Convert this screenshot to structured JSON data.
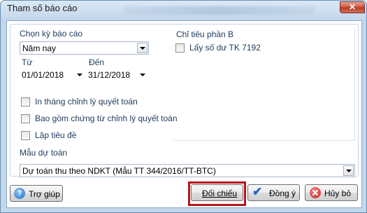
{
  "window": {
    "title": "Tham số báo cáo",
    "close_symbol": "✕"
  },
  "report_period": {
    "label": "Chọn kỳ báo cáo",
    "selected": "Năm nay"
  },
  "from": {
    "label": "Từ",
    "value": "01/01/2018"
  },
  "to": {
    "label": "Đến",
    "value": "31/12/2018"
  },
  "part_b": {
    "label": "Chỉ tiêu phần B",
    "checkbox_label": "Lấy số dư TK 7192",
    "checked": false
  },
  "options": [
    {
      "label": "In tháng chỉnh lý quyết toán",
      "checked": false
    },
    {
      "label": "Bao gồm chứng từ chỉnh lý quyết toán",
      "checked": false
    },
    {
      "label": "Lập tiêu đề",
      "checked": false
    }
  ],
  "template": {
    "label": "Mẫu dự toán",
    "selected": "Dự toán thu theo NDKT (Mẫu TT 344/2016/TT-BTC)"
  },
  "buttons": {
    "help": "Trợ giúp",
    "reconcile": "Đối chiếu",
    "ok": "Đồng ý",
    "cancel": "Hủy bỏ"
  },
  "icons": {
    "help": "question-icon",
    "ok": "checkmark-icon",
    "cancel": "no-entry-icon"
  },
  "colors": {
    "highlight": "#b8141c",
    "label_text": "#1e3a5c"
  }
}
